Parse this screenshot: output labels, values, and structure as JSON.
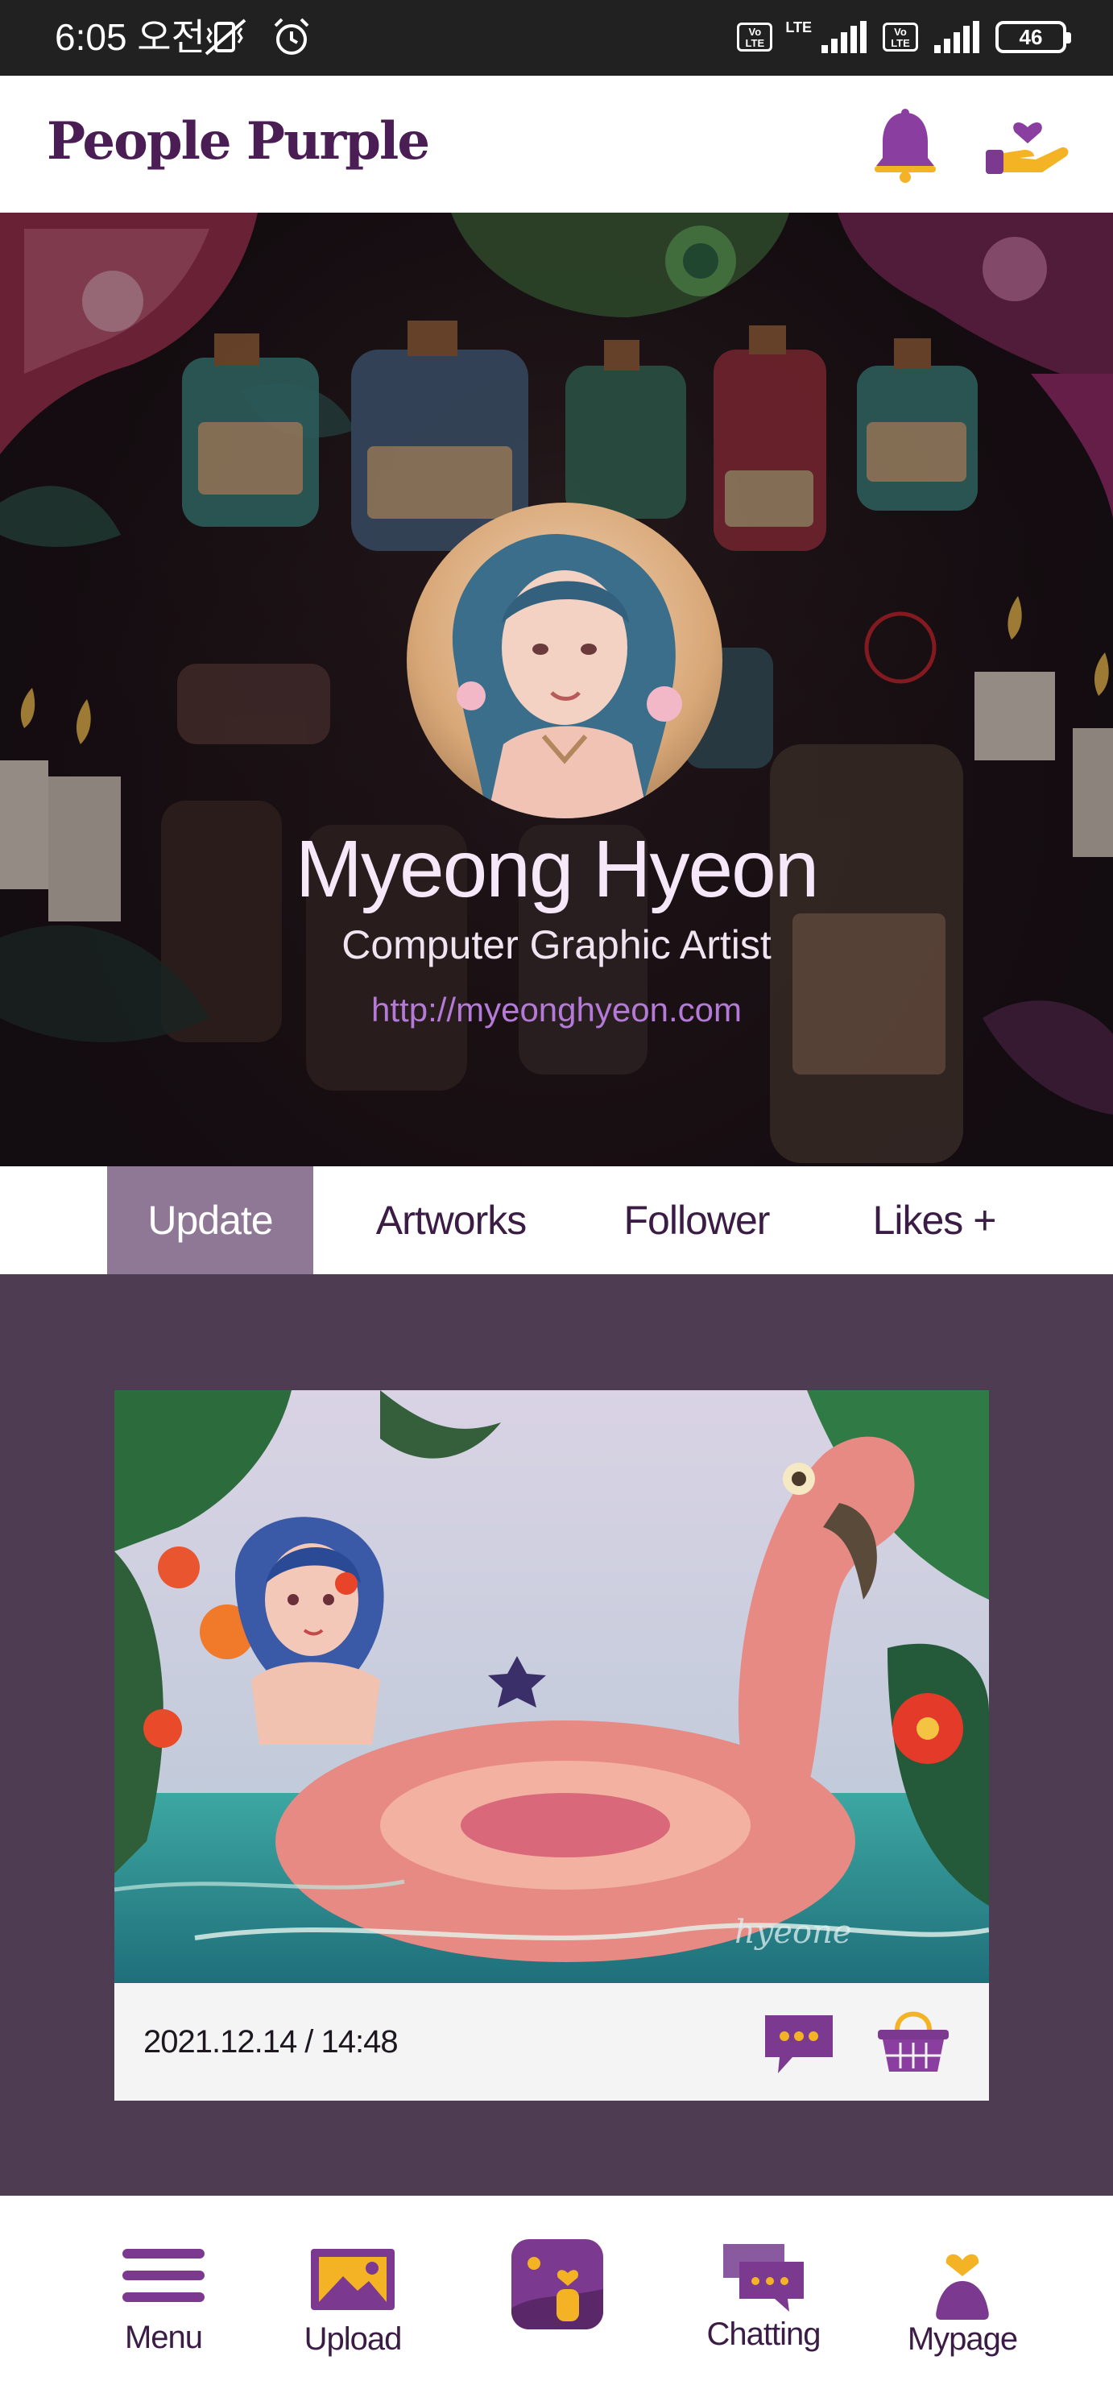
{
  "status_bar": {
    "time": "6:05 오전",
    "lte_label": "LTE",
    "volte_label": "Vo LTE",
    "battery": "46"
  },
  "header": {
    "logo": "People Purple"
  },
  "profile": {
    "name": "Myeong Hyeon",
    "role": "Computer Graphic Artist",
    "url": "http://myeonghyeon.com"
  },
  "tabs": [
    {
      "label": "Update",
      "active": true
    },
    {
      "label": "Artworks",
      "active": false
    },
    {
      "label": "Follower",
      "active": false
    },
    {
      "label": "Likes +",
      "active": false
    }
  ],
  "post": {
    "date": "2021.12.14  / 14:48",
    "signature": "hyeone"
  },
  "bottom_nav": [
    {
      "label": "Menu",
      "icon": "hamburger-icon"
    },
    {
      "label": "Upload",
      "icon": "image-upload-icon"
    },
    {
      "label": "",
      "icon": "gallery-person-icon"
    },
    {
      "label": "Chatting",
      "icon": "chat-bubbles-icon"
    },
    {
      "label": "Mypage",
      "icon": "person-heart-icon"
    }
  ],
  "colors": {
    "brand_purple": "#4a1e55",
    "icon_purple": "#7b3a8f",
    "accent_yellow": "#f4b324",
    "feed_background": "#4e3c53",
    "active_tab": "#8f7896",
    "link": "#b57ad8"
  }
}
